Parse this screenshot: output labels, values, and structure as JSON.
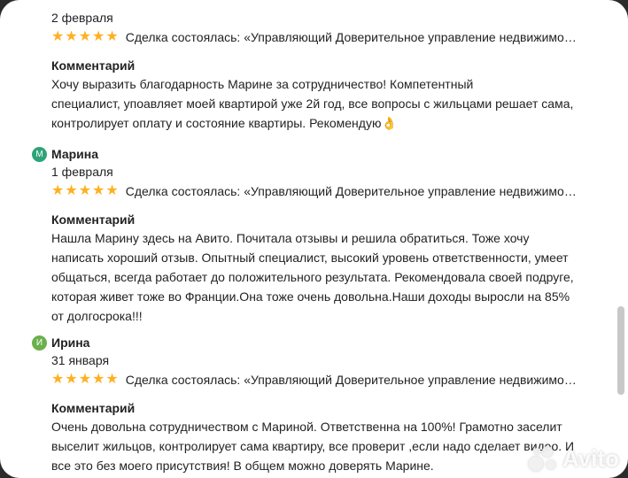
{
  "reviews": [
    {
      "date": "2 февраля",
      "deal": "Сделка состоялась: «Управляющий Доверительное управление недвижимо…",
      "comment_heading": "Комментарий",
      "comment_lines": [
        "Хочу выразить благодарность Марине за сотрудничество! Компетентный",
        "специалист, упоавляет моей квартирой уже 2й год, все вопросы с жильцами решает сама,",
        "контролирует оплату и состояние квартиры. Рекомендую👌"
      ]
    },
    {
      "avatar": "М",
      "avatar_color": "#2ea37a",
      "name": "Марина",
      "date": "1 февраля",
      "deal": "Сделка состоялась: «Управляющий Доверительное управление недвижимо…",
      "comment_heading": "Комментарий",
      "comment_lines": [
        "Нашла Марину здесь на Авито. Почитала отзывы и решила обратиться. Тоже хочу",
        "написать хороший отзыв. Опытный  специалист, высокий уровень ответственности, умеет",
        "общаться, всегда работает до положительного результата. Рекомендовала своей подруге,",
        "которая живет тоже во Франции.Она тоже очень довольна.Наши доходы выросли на  85%",
        "от долгосрока!!!"
      ]
    },
    {
      "avatar": "И",
      "avatar_color": "#6ab04c",
      "name": "Ирина",
      "date": "31 января",
      "deal": "Сделка состоялась: «Управляющий Доверительное управление недвижимо…",
      "comment_heading": "Комментарий",
      "comment_lines": [
        "Очень довольна сотрудничеством с Мариной. Ответственна на 100%! Грамотно заселит",
        "выселит  жильцов, контролирует  сама квартиру, все проверит ,если надо  сделает видео. И",
        "все это без моего присутствия! В общем можно доверять Марине."
      ]
    }
  ],
  "rating": 5,
  "watermark": "Avito"
}
